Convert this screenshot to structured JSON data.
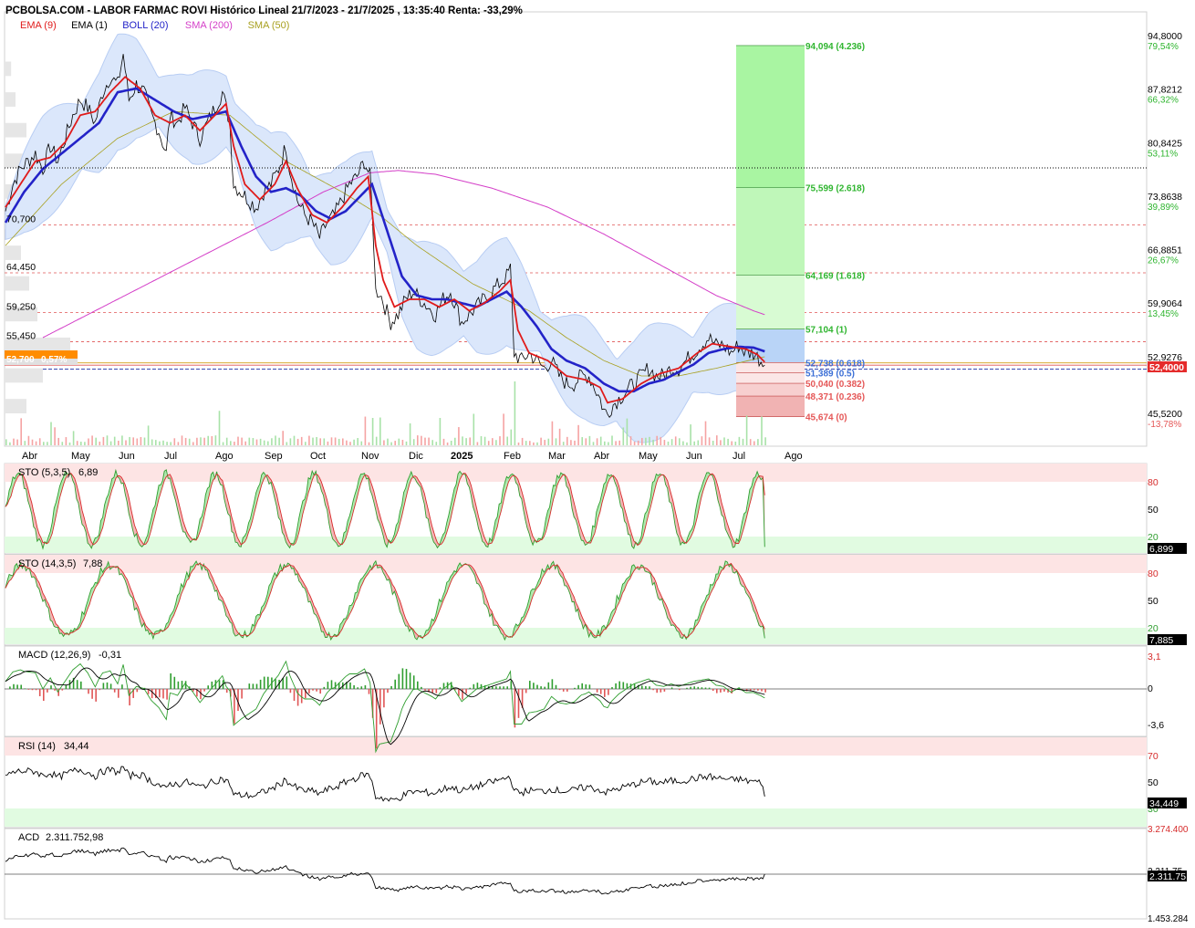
{
  "header": {
    "title": "PCBOLSA.COM - LABOR FARMAC ROVI Histórico Lineal 21/7/2023 - 21/7/2025 , 13:35:40 Renta: -33,29%"
  },
  "legend": [
    {
      "label": "EMA (9)",
      "color": "#e01b1b"
    },
    {
      "label": "EMA (1)",
      "color": "#000000"
    },
    {
      "label": "BOLL (20)",
      "color": "#2323c8"
    },
    {
      "label": "SMA (200)",
      "color": "#d43fc8"
    },
    {
      "label": "SMA (50)",
      "color": "#a8a020"
    }
  ],
  "colors": {
    "price": "#000000",
    "ema9": "#e01b1b",
    "boll": "#2323c8",
    "boll_band": "#dbe7fb",
    "sma200": "#d43fc8",
    "sma50": "#a8a020",
    "green": "#2f9e2f",
    "red": "#d62b2b",
    "fib_up": "#2fb52f",
    "fib_down": "#e55757"
  },
  "right_axis": [
    {
      "value": "94,8000",
      "pct": "79,54%",
      "pct_color": "#2fb52f"
    },
    {
      "value": "87,8212",
      "pct": "66,32%",
      "pct_color": "#2fb52f"
    },
    {
      "value": "80,8425",
      "pct": "53,11%",
      "pct_color": "#2fb52f"
    },
    {
      "value": "73,8638",
      "pct": "39,89%",
      "pct_color": "#2fb52f"
    },
    {
      "value": "66,8851",
      "pct": "26,67%",
      "pct_color": "#2fb52f"
    },
    {
      "value": "59,9064",
      "pct": "13,45%",
      "pct_color": "#2fb52f"
    },
    {
      "value": "52,9276",
      "pct": "",
      "pct_color": "#2fb52f"
    },
    {
      "value": "45,5200",
      "pct": "-13,78%",
      "pct_color": "#e55757"
    }
  ],
  "current_price_label": "52,4000",
  "left_levels": [
    {
      "label": "70,700",
      "value": 70.7
    },
    {
      "label": "64,450",
      "value": 64.45
    },
    {
      "label": "59,250",
      "value": 59.25
    },
    {
      "label": "55,450",
      "value": 55.45
    }
  ],
  "left_price_badge": {
    "price": "52,700",
    "change": "0,57%"
  },
  "fib_levels": [
    {
      "label": "94,094 (4.236)",
      "value": 94.094
    },
    {
      "label": "75,599 (2.618)",
      "value": 75.599
    },
    {
      "label": "64,169 (1.618)",
      "value": 64.169
    },
    {
      "label": "57,104 (1)",
      "value": 57.104
    },
    {
      "label": "52,738 (0.618)",
      "value": 52.738
    },
    {
      "label": "51,389 (0.5)",
      "value": 51.389
    },
    {
      "label": "50,040 (0.382)",
      "value": 50.04
    },
    {
      "label": "48,371 (0.236)",
      "value": 48.371
    },
    {
      "label": "45,674 (0)",
      "value": 45.674
    }
  ],
  "x_labels": [
    "Abr",
    "May",
    "Jun",
    "Jul",
    "Ago",
    "Sep",
    "Oct",
    "Nov",
    "Dic",
    "2025",
    "Feb",
    "Mar",
    "Abr",
    "May",
    "Jun",
    "Jul",
    "Ago"
  ],
  "panels": {
    "sto1": {
      "title": "STO (5,3,5)",
      "value": "6,89",
      "axis": [
        "80",
        "50",
        "20"
      ],
      "last": "6,899"
    },
    "sto2": {
      "title": "STO (14,3,5)",
      "value": "7,88",
      "axis": [
        "80",
        "50",
        "20"
      ],
      "last": "7,885"
    },
    "macd": {
      "title": "MACD (12,26,9)",
      "value": "-0,31",
      "axis": [
        "3,1",
        "0",
        "-3,6"
      ]
    },
    "rsi": {
      "title": "RSI (14)",
      "value": "34,44",
      "axis": [
        "70",
        "50",
        "30"
      ],
      "last": "34,449"
    },
    "acd": {
      "title": "ACD",
      "value": "2.311.752,98",
      "axis": [
        "3.274.400",
        "2.311.75",
        "1.453.284"
      ],
      "last": "2.311.75"
    }
  },
  "chart_data": {
    "type": "line",
    "title": "PCBOLSA.COM - LABOR FARMAC ROVI Histórico Lineal 21/7/2023 - 21/7/2025",
    "period": "21/7/2023 - 21/7/2025",
    "return": "-33,29%",
    "last_price": 52.4,
    "ylim": [
      45.52,
      94.8
    ],
    "price_path": [
      [
        0,
        72.5
      ],
      [
        4,
        76
      ],
      [
        8,
        78
      ],
      [
        12,
        79
      ],
      [
        16,
        80
      ],
      [
        20,
        78
      ],
      [
        24,
        81
      ],
      [
        28,
        79
      ],
      [
        32,
        82
      ],
      [
        36,
        85
      ],
      [
        40,
        87
      ],
      [
        44,
        86
      ],
      [
        48,
        84
      ],
      [
        52,
        88
      ],
      [
        56,
        90
      ],
      [
        60,
        89
      ],
      [
        63,
        93
      ],
      [
        66,
        87
      ],
      [
        70,
        89
      ],
      [
        74,
        88
      ],
      [
        78,
        85
      ],
      [
        82,
        83
      ],
      [
        86,
        80
      ],
      [
        88,
        85
      ],
      [
        92,
        84
      ],
      [
        96,
        86
      ],
      [
        100,
        84
      ],
      [
        104,
        82
      ],
      [
        108,
        84
      ],
      [
        112,
        86
      ],
      [
        116,
        88
      ],
      [
        118,
        86
      ],
      [
        120,
        84
      ],
      [
        122,
        76
      ],
      [
        126,
        75
      ],
      [
        130,
        74
      ],
      [
        134,
        73
      ],
      [
        138,
        75
      ],
      [
        142,
        76
      ],
      [
        146,
        78
      ],
      [
        150,
        81
      ],
      [
        152,
        78
      ],
      [
        156,
        74
      ],
      [
        160,
        72
      ],
      [
        164,
        71
      ],
      [
        168,
        69
      ],
      [
        172,
        71
      ],
      [
        176,
        72
      ],
      [
        180,
        74
      ],
      [
        184,
        76
      ],
      [
        188,
        77
      ],
      [
        192,
        79
      ],
      [
        195,
        77
      ],
      [
        197,
        68
      ],
      [
        198,
        62
      ],
      [
        200,
        62
      ],
      [
        203,
        60
      ],
      [
        206,
        58
      ],
      [
        210,
        59
      ],
      [
        214,
        61
      ],
      [
        218,
        62
      ],
      [
        222,
        61
      ],
      [
        226,
        60
      ],
      [
        230,
        59
      ],
      [
        234,
        61
      ],
      [
        238,
        62
      ],
      [
        241,
        60
      ],
      [
        244,
        58
      ],
      [
        248,
        59
      ],
      [
        252,
        60
      ],
      [
        256,
        61
      ],
      [
        260,
        62
      ],
      [
        264,
        63
      ],
      [
        268,
        64
      ],
      [
        270,
        65
      ],
      [
        272,
        54
      ],
      [
        276,
        53
      ],
      [
        280,
        54
      ],
      [
        284,
        53
      ],
      [
        288,
        52
      ],
      [
        292,
        53
      ],
      [
        296,
        51
      ],
      [
        300,
        50
      ],
      [
        304,
        50
      ],
      [
        308,
        51
      ],
      [
        312,
        51
      ],
      [
        316,
        49
      ],
      [
        318,
        48
      ],
      [
        320,
        46.5
      ],
      [
        322,
        46
      ],
      [
        324,
        47
      ],
      [
        328,
        48
      ],
      [
        332,
        49
      ],
      [
        336,
        50
      ],
      [
        340,
        51
      ],
      [
        344,
        52
      ],
      [
        348,
        51
      ],
      [
        352,
        51
      ],
      [
        356,
        52
      ],
      [
        360,
        52
      ],
      [
        364,
        53
      ],
      [
        368,
        54
      ],
      [
        372,
        55
      ],
      [
        376,
        56
      ],
      [
        380,
        55
      ],
      [
        384,
        55
      ],
      [
        388,
        54
      ],
      [
        392,
        55
      ],
      [
        396,
        54
      ],
      [
        400,
        54
      ],
      [
        404,
        53
      ],
      [
        406,
        52.4
      ]
    ],
    "ema9_path": [
      [
        0,
        73
      ],
      [
        8,
        76
      ],
      [
        16,
        79
      ],
      [
        24,
        79.5
      ],
      [
        32,
        81.5
      ],
      [
        40,
        85
      ],
      [
        48,
        85.5
      ],
      [
        56,
        88
      ],
      [
        64,
        90
      ],
      [
        72,
        88.5
      ],
      [
        80,
        85
      ],
      [
        88,
        84
      ],
      [
        96,
        85
      ],
      [
        104,
        83
      ],
      [
        112,
        85
      ],
      [
        118,
        86.5
      ],
      [
        122,
        81
      ],
      [
        128,
        76
      ],
      [
        136,
        74
      ],
      [
        144,
        76
      ],
      [
        150,
        79
      ],
      [
        156,
        75.5
      ],
      [
        164,
        72
      ],
      [
        172,
        71
      ],
      [
        180,
        73
      ],
      [
        188,
        75.5
      ],
      [
        194,
        77
      ],
      [
        198,
        68
      ],
      [
        202,
        63.5
      ],
      [
        208,
        60
      ],
      [
        216,
        61
      ],
      [
        224,
        61
      ],
      [
        232,
        60
      ],
      [
        240,
        61
      ],
      [
        248,
        59.5
      ],
      [
        256,
        60.5
      ],
      [
        264,
        62
      ],
      [
        270,
        63.5
      ],
      [
        274,
        57
      ],
      [
        280,
        54
      ],
      [
        290,
        53
      ],
      [
        300,
        51
      ],
      [
        310,
        50.5
      ],
      [
        318,
        49.5
      ],
      [
        322,
        47.5
      ],
      [
        330,
        48
      ],
      [
        340,
        50
      ],
      [
        350,
        51.3
      ],
      [
        360,
        52
      ],
      [
        370,
        54
      ],
      [
        378,
        55.2
      ],
      [
        388,
        54.8
      ],
      [
        396,
        54.5
      ],
      [
        402,
        53.8
      ],
      [
        406,
        52.8
      ]
    ],
    "boll_mid_path": [
      [
        0,
        71
      ],
      [
        10,
        75
      ],
      [
        20,
        78
      ],
      [
        30,
        80
      ],
      [
        40,
        82
      ],
      [
        50,
        84
      ],
      [
        60,
        88
      ],
      [
        70,
        88.5
      ],
      [
        80,
        87
      ],
      [
        90,
        85.5
      ],
      [
        100,
        84.5
      ],
      [
        110,
        85
      ],
      [
        118,
        85.5
      ],
      [
        126,
        81
      ],
      [
        134,
        77
      ],
      [
        142,
        75
      ],
      [
        150,
        75.5
      ],
      [
        158,
        74.5
      ],
      [
        166,
        72.5
      ],
      [
        174,
        71.5
      ],
      [
        182,
        72.5
      ],
      [
        190,
        74.5
      ],
      [
        196,
        76
      ],
      [
        204,
        70
      ],
      [
        212,
        64
      ],
      [
        220,
        61.5
      ],
      [
        228,
        61
      ],
      [
        236,
        61
      ],
      [
        244,
        60.5
      ],
      [
        252,
        60
      ],
      [
        260,
        61
      ],
      [
        268,
        62
      ],
      [
        276,
        60
      ],
      [
        284,
        57.5
      ],
      [
        292,
        54.5
      ],
      [
        300,
        53
      ],
      [
        310,
        52
      ],
      [
        320,
        50
      ],
      [
        328,
        49
      ],
      [
        336,
        49
      ],
      [
        344,
        50
      ],
      [
        352,
        50.5
      ],
      [
        360,
        51.5
      ],
      [
        368,
        52.5
      ],
      [
        376,
        54
      ],
      [
        384,
        54.5
      ],
      [
        392,
        54.8
      ],
      [
        400,
        54.7
      ],
      [
        406,
        54.2
      ]
    ],
    "sma200_path": [
      [
        20,
        56
      ],
      [
        60,
        61
      ],
      [
        100,
        66
      ],
      [
        140,
        71
      ],
      [
        170,
        75
      ],
      [
        195,
        77.5
      ],
      [
        210,
        77.8
      ],
      [
        230,
        77.3
      ],
      [
        260,
        75.5
      ],
      [
        290,
        73
      ],
      [
        320,
        69.5
      ],
      [
        350,
        65.5
      ],
      [
        380,
        61.5
      ],
      [
        400,
        59.5
      ],
      [
        406,
        59
      ]
    ],
    "sma50_path": [
      [
        0,
        68
      ],
      [
        30,
        76
      ],
      [
        60,
        82
      ],
      [
        90,
        85.5
      ],
      [
        120,
        85
      ],
      [
        150,
        79
      ],
      [
        180,
        75
      ],
      [
        200,
        72
      ],
      [
        220,
        68
      ],
      [
        250,
        63
      ],
      [
        280,
        59.5
      ],
      [
        300,
        56
      ],
      [
        320,
        53
      ],
      [
        340,
        51
      ],
      [
        360,
        51
      ],
      [
        380,
        52
      ],
      [
        406,
        53.5
      ]
    ],
    "fib_levels": [
      94.094,
      75.599,
      64.169,
      57.104,
      52.738,
      51.389,
      50.04,
      48.371,
      45.674
    ]
  }
}
